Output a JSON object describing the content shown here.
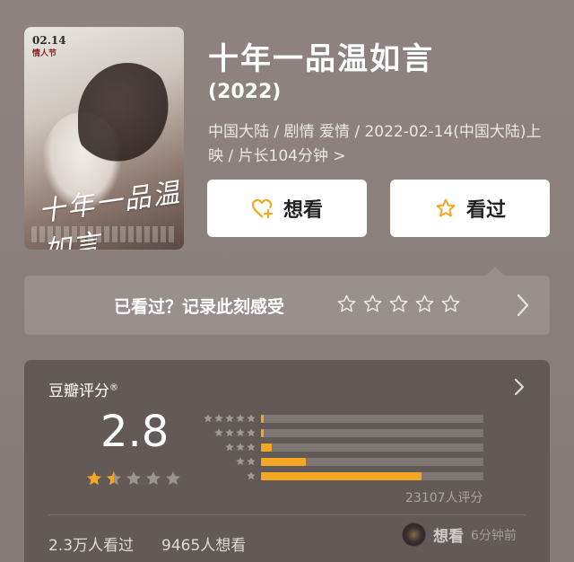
{
  "poster": {
    "date": "02.14",
    "festival": "情人节",
    "script_title": "十年一品温如言"
  },
  "movie": {
    "title": "十年一品温如言",
    "year": "(2022)",
    "meta": "中国大陆 / 剧情 爱情 / 2022-02-14(中国大陆)上映 / 片长104分钟",
    "meta_chevron": ">"
  },
  "actions": {
    "want_label": "想看",
    "seen_label": "看过"
  },
  "record": {
    "prompt": "已看过？记录此刻感受"
  },
  "rating": {
    "label": "豆瓣评分",
    "registered_mark": "®",
    "score": "2.8",
    "stars_filled": 1.5,
    "distribution": [
      {
        "stars": 5,
        "fraction": 0.01
      },
      {
        "stars": 4,
        "fraction": 0.005
      },
      {
        "stars": 3,
        "fraction": 0.05
      },
      {
        "stars": 2,
        "fraction": 0.2
      },
      {
        "stars": 1,
        "fraction": 0.72
      }
    ],
    "rating_count": "23107人评分",
    "seen_count": "2.3万人看过",
    "want_count": "9465人想看",
    "activity_action": "想看",
    "activity_time": "6分钟前"
  },
  "colors": {
    "accent": "#f5a623",
    "background": "#8a7f7b",
    "card": "#635956"
  }
}
